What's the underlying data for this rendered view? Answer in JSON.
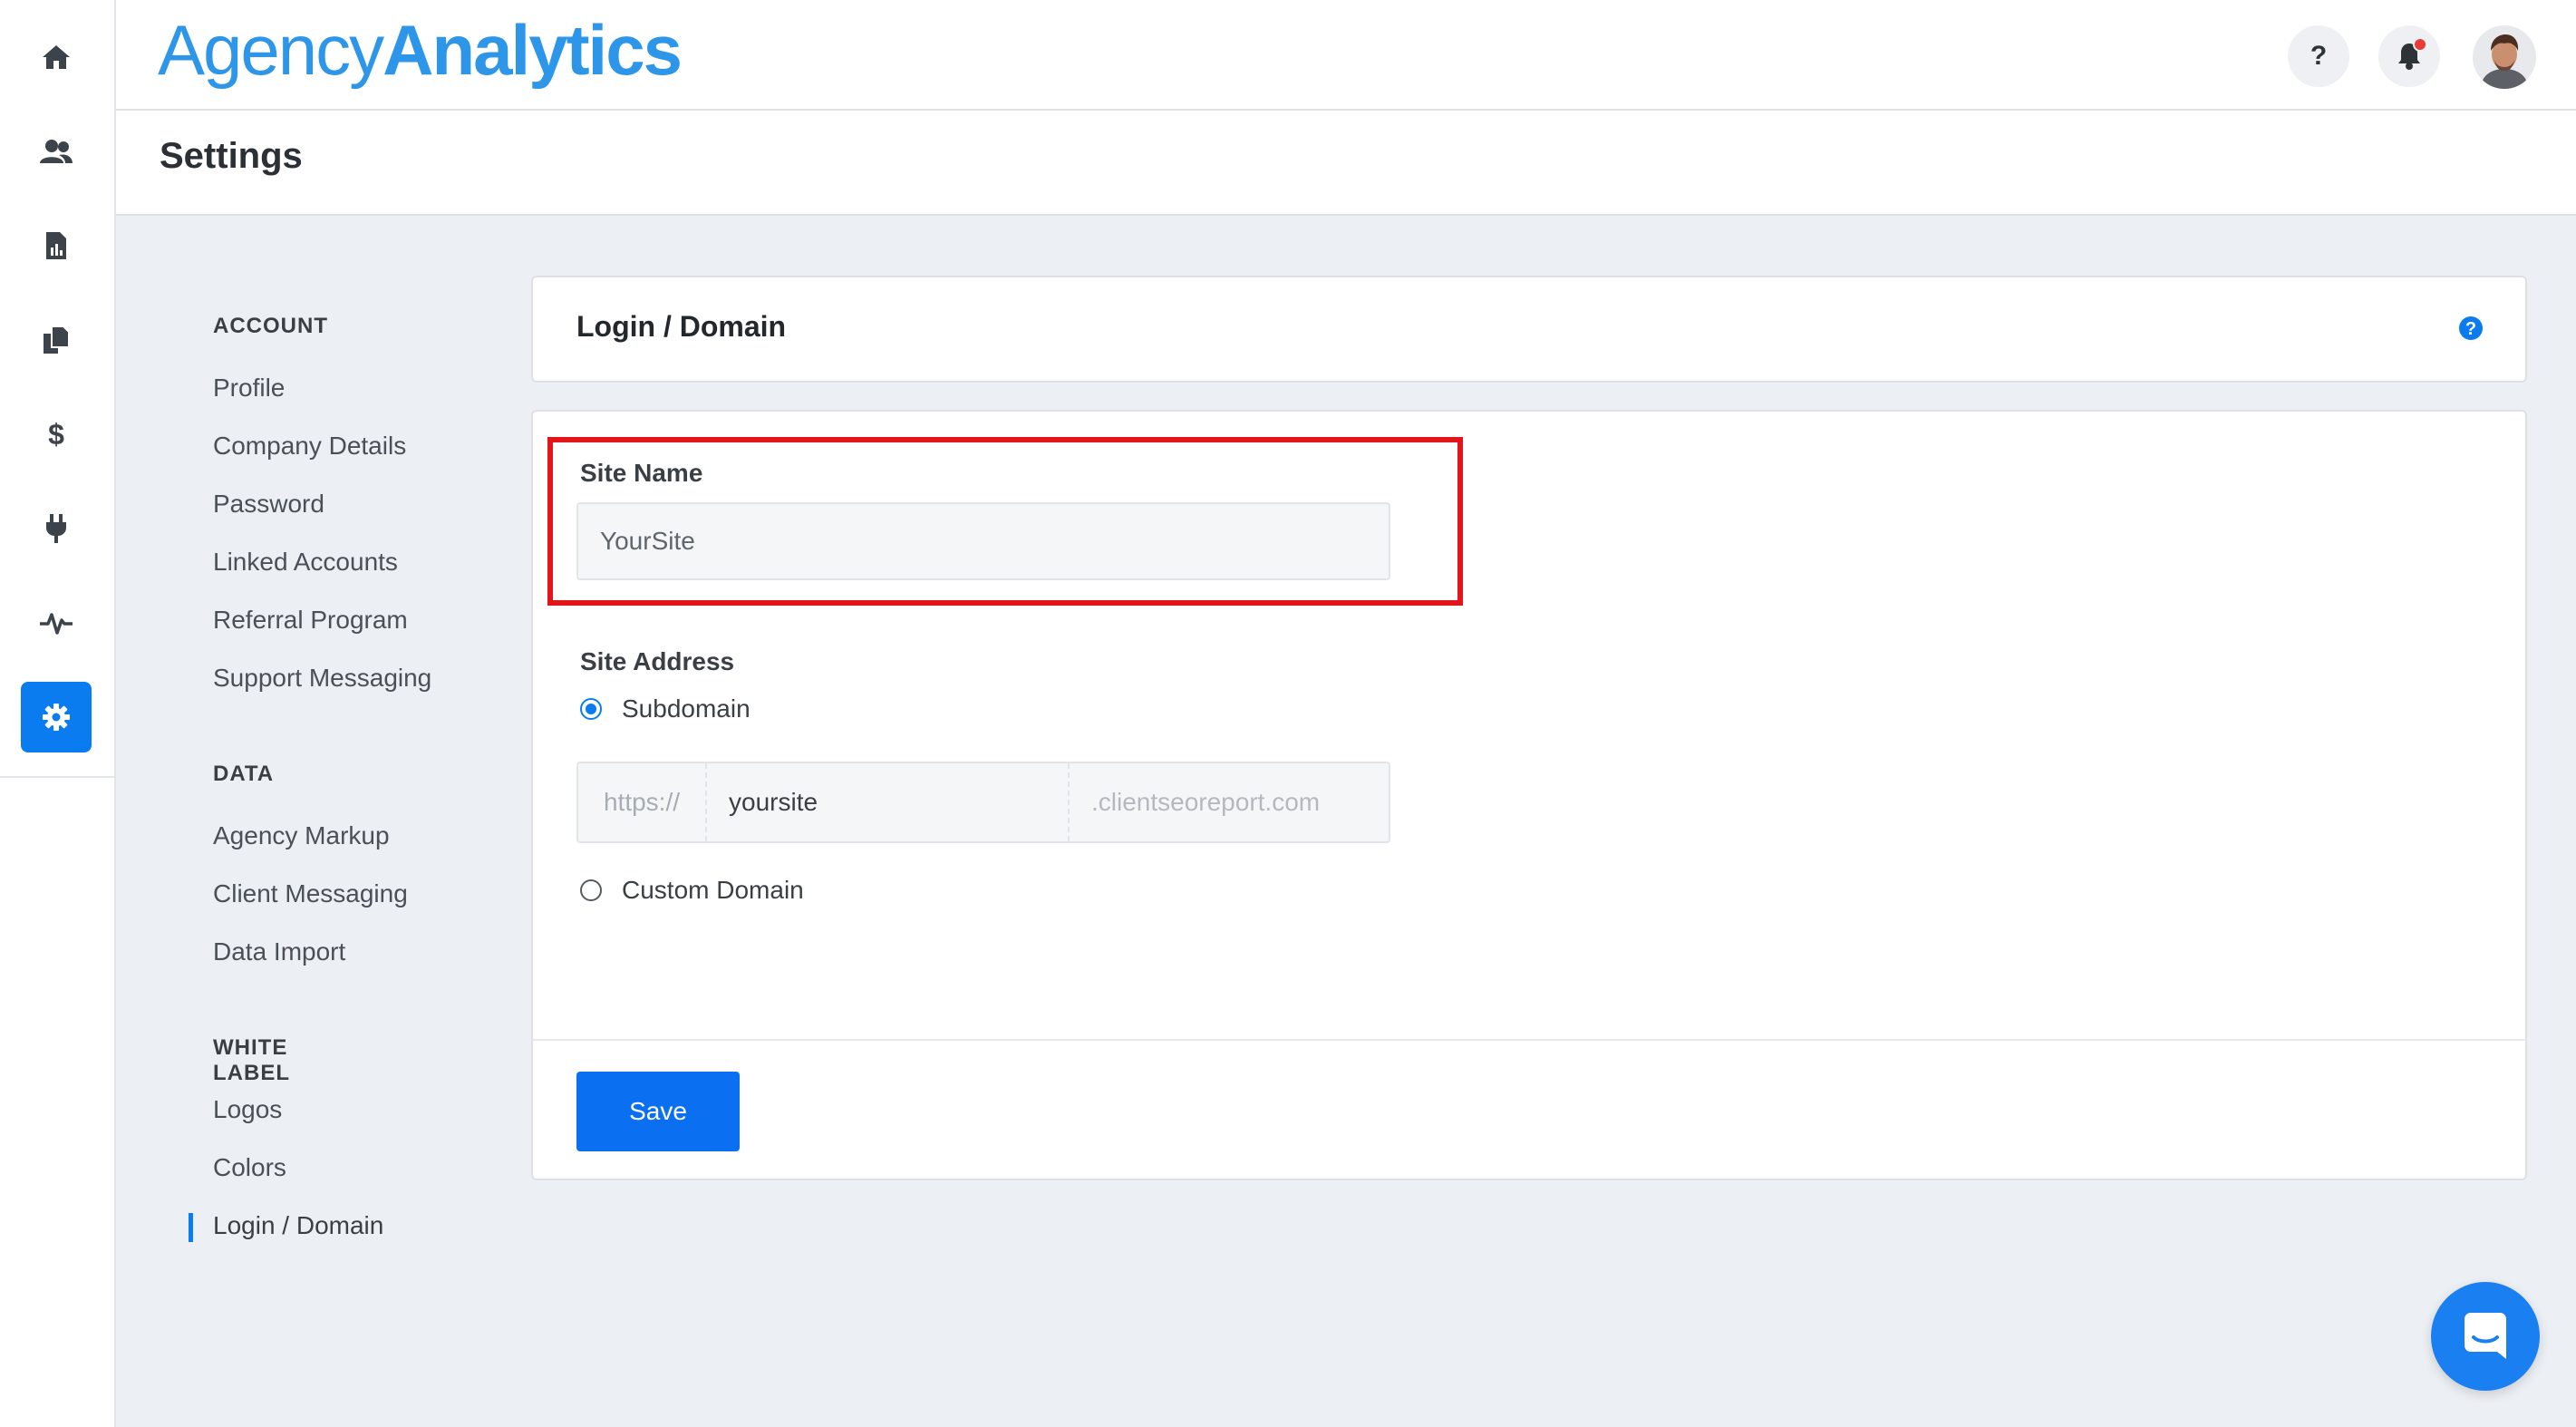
{
  "brand": {
    "logo_light": "Agency",
    "logo_bold": "Analytics",
    "accent": "#0a7cf0",
    "logo_color": "#2d96e8"
  },
  "rail": {
    "items": [
      {
        "icon": "home-icon"
      },
      {
        "icon": "users-icon"
      },
      {
        "icon": "report-icon"
      },
      {
        "icon": "documents-icon"
      },
      {
        "icon": "dollar-icon"
      },
      {
        "icon": "plug-icon"
      },
      {
        "icon": "activity-icon"
      },
      {
        "icon": "gear-icon",
        "active": true
      }
    ]
  },
  "header": {
    "help_label": "?",
    "notification_icon": "bell-icon",
    "avatar_icon": "user-avatar"
  },
  "page": {
    "title": "Settings"
  },
  "menu": {
    "account_heading": "ACCOUNT",
    "account_items": [
      "Profile",
      "Company Details",
      "Password",
      "Linked Accounts",
      "Referral Program",
      "Support Messaging"
    ],
    "data_heading": "DATA",
    "data_items": [
      "Agency Markup",
      "Client Messaging",
      "Data Import"
    ],
    "white_label_heading": "WHITE LABEL",
    "white_label_items": [
      "Logos",
      "Colors",
      "Login / Domain"
    ],
    "active_item": "Login / Domain"
  },
  "card": {
    "title": "Login / Domain",
    "help_icon": "help-circle-icon"
  },
  "form": {
    "site_name_label": "Site Name",
    "site_name_value": "YourSite",
    "site_address_label": "Site Address",
    "subdomain_label": "Subdomain",
    "subdomain_checked": true,
    "prefix": "https://",
    "subdomain_value": "yoursite",
    "suffix": ".clientseoreport.com",
    "custom_domain_label": "Custom Domain",
    "custom_domain_checked": false,
    "save_label": "Save",
    "highlight_color": "#e2151b"
  },
  "chat": {
    "icon": "chat-icon"
  }
}
